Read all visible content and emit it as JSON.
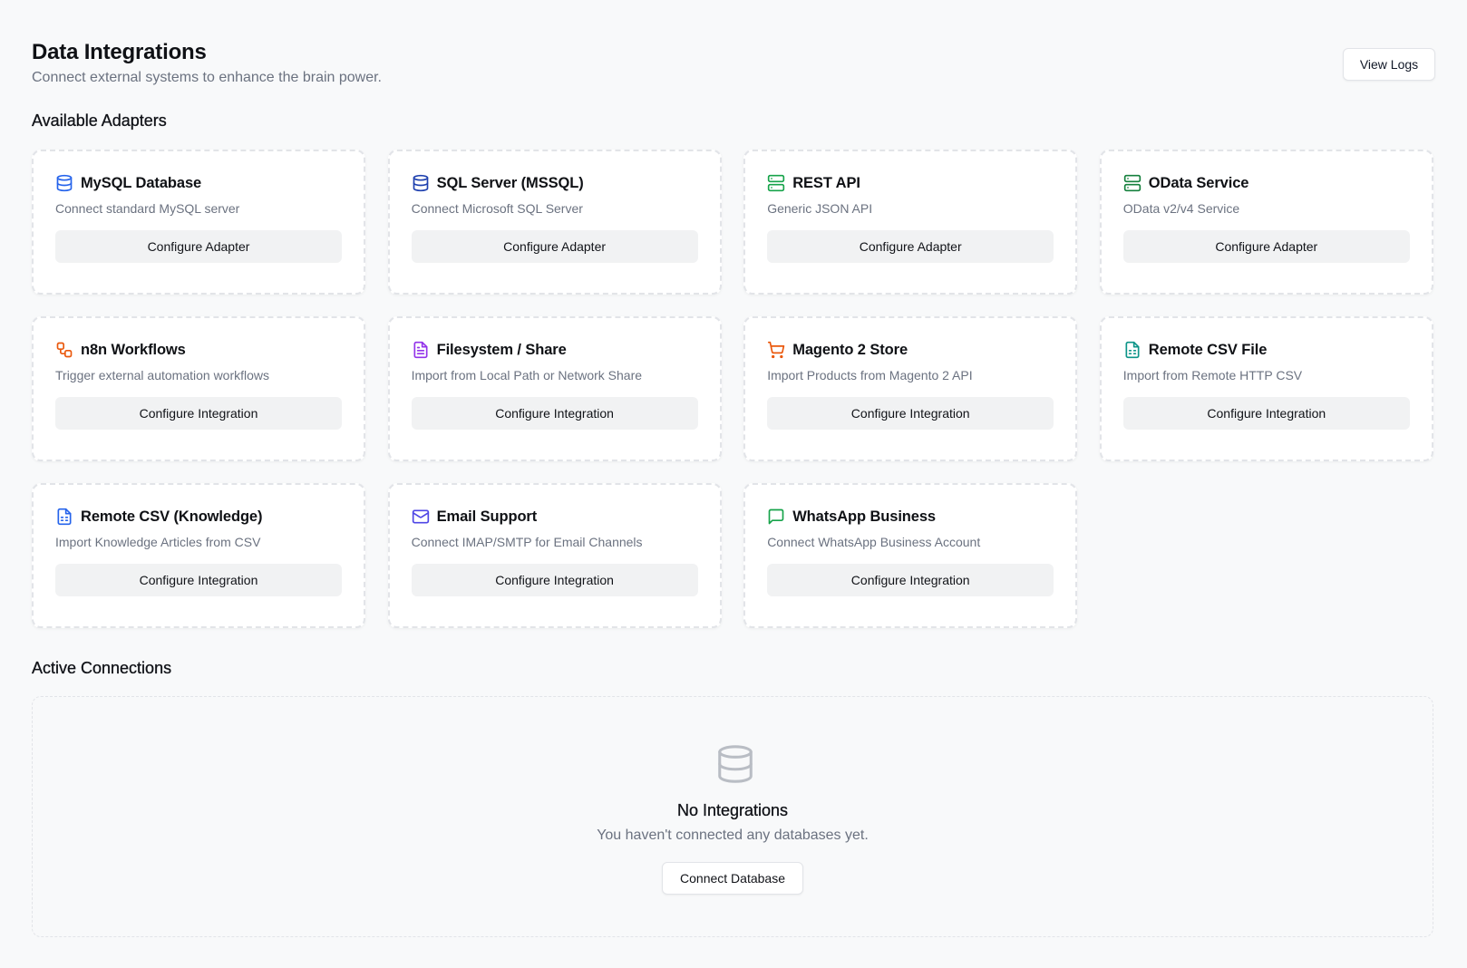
{
  "header": {
    "title": "Data Integrations",
    "subtitle": "Connect external systems to enhance the brain power.",
    "view_logs_label": "View Logs"
  },
  "sections": {
    "available": "Available Adapters",
    "active": "Active Connections"
  },
  "adapters": [
    {
      "title": "MySQL Database",
      "description": "Connect standard MySQL server",
      "button": "Configure Adapter",
      "icon": "database-icon",
      "color": "#2563eb"
    },
    {
      "title": "SQL Server (MSSQL)",
      "description": "Connect Microsoft SQL Server",
      "button": "Configure Adapter",
      "icon": "database-icon",
      "color": "#1e40af"
    },
    {
      "title": "REST API",
      "description": "Generic JSON API",
      "button": "Configure Adapter",
      "icon": "server-icon",
      "color": "#16a34a"
    },
    {
      "title": "OData Service",
      "description": "OData v2/v4 Service",
      "button": "Configure Adapter",
      "icon": "server-icon",
      "color": "#15803d"
    },
    {
      "title": "n8n Workflows",
      "description": "Trigger external automation workflows",
      "button": "Configure Integration",
      "icon": "workflow-icon",
      "color": "#ea580c"
    },
    {
      "title": "Filesystem / Share",
      "description": "Import from Local Path or Network Share",
      "button": "Configure Integration",
      "icon": "file-text-icon",
      "color": "#9333ea"
    },
    {
      "title": "Magento 2 Store",
      "description": "Import Products from Magento 2 API",
      "button": "Configure Integration",
      "icon": "shopping-cart-icon",
      "color": "#ea580c"
    },
    {
      "title": "Remote CSV File",
      "description": "Import from Remote HTTP CSV",
      "button": "Configure Integration",
      "icon": "file-spreadsheet-icon",
      "color": "#0d9488"
    },
    {
      "title": "Remote CSV (Knowledge)",
      "description": "Import Knowledge Articles from CSV",
      "button": "Configure Integration",
      "icon": "file-spreadsheet-icon",
      "color": "#2563eb"
    },
    {
      "title": "Email Support",
      "description": "Connect IMAP/SMTP for Email Channels",
      "button": "Configure Integration",
      "icon": "mail-icon",
      "color": "#4f46e5"
    },
    {
      "title": "WhatsApp Business",
      "description": "Connect WhatsApp Business Account",
      "button": "Configure Integration",
      "icon": "message-square-icon",
      "color": "#16a34a"
    }
  ],
  "empty_state": {
    "icon": "database-icon",
    "title": "No Integrations",
    "text": "You haven't connected any databases yet.",
    "button": "Connect Database"
  }
}
